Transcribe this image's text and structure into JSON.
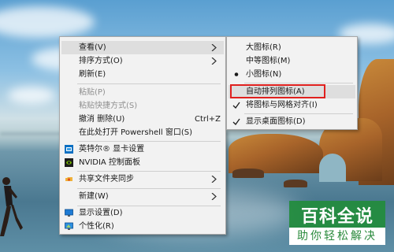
{
  "main_menu": {
    "items": [
      {
        "label": "查看(V)"
      },
      {
        "label": "排序方式(O)"
      },
      {
        "label": "刷新(E)"
      },
      {
        "label": "粘贴(P)"
      },
      {
        "label": "粘贴快捷方式(S)"
      },
      {
        "label": "撤消 删除(U)",
        "shortcut": "Ctrl+Z"
      },
      {
        "label": "在此处打开 Powershell 窗口(S)"
      },
      {
        "label": "英特尔® 显卡设置",
        "icon": "intel-graphics-icon"
      },
      {
        "label": "NVIDIA 控制面板",
        "icon": "nvidia-icon"
      },
      {
        "label": "共享文件夹同步",
        "icon": "share-sync-icon"
      },
      {
        "label": "新建(W)"
      },
      {
        "label": "显示设置(D)",
        "icon": "display-icon"
      },
      {
        "label": "个性化(R)",
        "icon": "personalize-icon"
      }
    ]
  },
  "view_submenu": {
    "items": [
      {
        "label": "大图标(R)"
      },
      {
        "label": "中等图标(M)"
      },
      {
        "label": "小图标(N)",
        "mark": "bullet"
      },
      {
        "label": "自动排列图标(A)"
      },
      {
        "label": "将图标与网格对齐(I)",
        "mark": "check"
      },
      {
        "label": "显示桌面图标(D)",
        "mark": "check"
      }
    ]
  },
  "watermark": {
    "line1": "百科全说",
    "line2": "助你轻松解决"
  },
  "colors": {
    "highlight_border": "#e0201e",
    "watermark_green": "#2a8a3c"
  }
}
